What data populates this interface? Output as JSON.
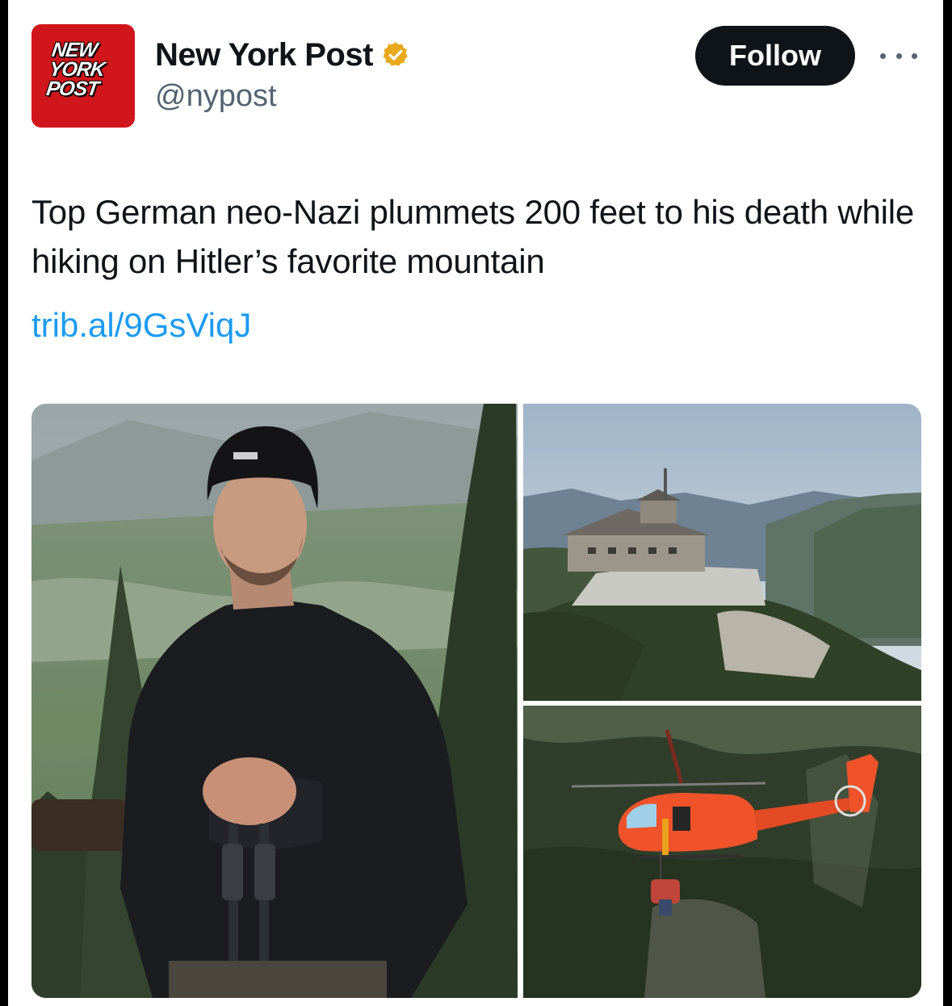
{
  "account": {
    "avatar_text": [
      "NEW",
      "YORK",
      "POST"
    ],
    "display_name": "New York Post",
    "handle": "@nypost",
    "verified": true,
    "verified_icon": "verified-badge-gold"
  },
  "actions": {
    "follow_label": "Follow",
    "more_icon": "ellipsis-icon"
  },
  "post": {
    "text": "Top German neo-Nazi plummets 200 feet to his death while hiking on Hitler’s favorite mountain",
    "link": "trib.al/9GsViqJ"
  },
  "media": {
    "count": 3,
    "images": [
      {
        "position": "left"
      },
      {
        "position": "top-right"
      },
      {
        "position": "bottom-right"
      }
    ]
  },
  "colors": {
    "brand_red": "#d1161b",
    "link_blue": "#1d9bf0",
    "text_primary": "#0f1419",
    "text_secondary": "#536471",
    "verified_gold": "#e8a91b",
    "helicopter_orange": "#f0532a"
  }
}
